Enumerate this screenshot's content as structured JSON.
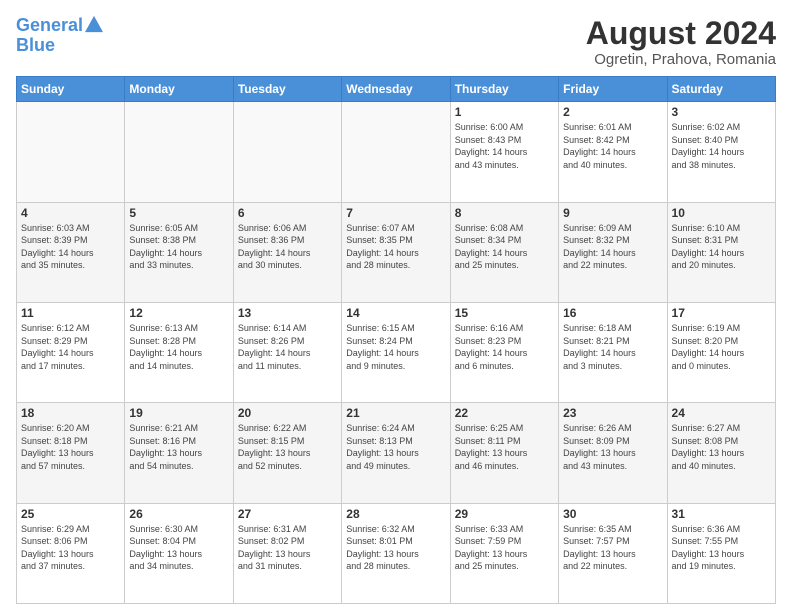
{
  "logo": {
    "line1": "General",
    "line2": "Blue"
  },
  "title": "August 2024",
  "subtitle": "Ogretin, Prahova, Romania",
  "days_header": [
    "Sunday",
    "Monday",
    "Tuesday",
    "Wednesday",
    "Thursday",
    "Friday",
    "Saturday"
  ],
  "weeks": [
    [
      {
        "day": "",
        "info": ""
      },
      {
        "day": "",
        "info": ""
      },
      {
        "day": "",
        "info": ""
      },
      {
        "day": "",
        "info": ""
      },
      {
        "day": "1",
        "info": "Sunrise: 6:00 AM\nSunset: 8:43 PM\nDaylight: 14 hours\nand 43 minutes."
      },
      {
        "day": "2",
        "info": "Sunrise: 6:01 AM\nSunset: 8:42 PM\nDaylight: 14 hours\nand 40 minutes."
      },
      {
        "day": "3",
        "info": "Sunrise: 6:02 AM\nSunset: 8:40 PM\nDaylight: 14 hours\nand 38 minutes."
      }
    ],
    [
      {
        "day": "4",
        "info": "Sunrise: 6:03 AM\nSunset: 8:39 PM\nDaylight: 14 hours\nand 35 minutes."
      },
      {
        "day": "5",
        "info": "Sunrise: 6:05 AM\nSunset: 8:38 PM\nDaylight: 14 hours\nand 33 minutes."
      },
      {
        "day": "6",
        "info": "Sunrise: 6:06 AM\nSunset: 8:36 PM\nDaylight: 14 hours\nand 30 minutes."
      },
      {
        "day": "7",
        "info": "Sunrise: 6:07 AM\nSunset: 8:35 PM\nDaylight: 14 hours\nand 28 minutes."
      },
      {
        "day": "8",
        "info": "Sunrise: 6:08 AM\nSunset: 8:34 PM\nDaylight: 14 hours\nand 25 minutes."
      },
      {
        "day": "9",
        "info": "Sunrise: 6:09 AM\nSunset: 8:32 PM\nDaylight: 14 hours\nand 22 minutes."
      },
      {
        "day": "10",
        "info": "Sunrise: 6:10 AM\nSunset: 8:31 PM\nDaylight: 14 hours\nand 20 minutes."
      }
    ],
    [
      {
        "day": "11",
        "info": "Sunrise: 6:12 AM\nSunset: 8:29 PM\nDaylight: 14 hours\nand 17 minutes."
      },
      {
        "day": "12",
        "info": "Sunrise: 6:13 AM\nSunset: 8:28 PM\nDaylight: 14 hours\nand 14 minutes."
      },
      {
        "day": "13",
        "info": "Sunrise: 6:14 AM\nSunset: 8:26 PM\nDaylight: 14 hours\nand 11 minutes."
      },
      {
        "day": "14",
        "info": "Sunrise: 6:15 AM\nSunset: 8:24 PM\nDaylight: 14 hours\nand 9 minutes."
      },
      {
        "day": "15",
        "info": "Sunrise: 6:16 AM\nSunset: 8:23 PM\nDaylight: 14 hours\nand 6 minutes."
      },
      {
        "day": "16",
        "info": "Sunrise: 6:18 AM\nSunset: 8:21 PM\nDaylight: 14 hours\nand 3 minutes."
      },
      {
        "day": "17",
        "info": "Sunrise: 6:19 AM\nSunset: 8:20 PM\nDaylight: 14 hours\nand 0 minutes."
      }
    ],
    [
      {
        "day": "18",
        "info": "Sunrise: 6:20 AM\nSunset: 8:18 PM\nDaylight: 13 hours\nand 57 minutes."
      },
      {
        "day": "19",
        "info": "Sunrise: 6:21 AM\nSunset: 8:16 PM\nDaylight: 13 hours\nand 54 minutes."
      },
      {
        "day": "20",
        "info": "Sunrise: 6:22 AM\nSunset: 8:15 PM\nDaylight: 13 hours\nand 52 minutes."
      },
      {
        "day": "21",
        "info": "Sunrise: 6:24 AM\nSunset: 8:13 PM\nDaylight: 13 hours\nand 49 minutes."
      },
      {
        "day": "22",
        "info": "Sunrise: 6:25 AM\nSunset: 8:11 PM\nDaylight: 13 hours\nand 46 minutes."
      },
      {
        "day": "23",
        "info": "Sunrise: 6:26 AM\nSunset: 8:09 PM\nDaylight: 13 hours\nand 43 minutes."
      },
      {
        "day": "24",
        "info": "Sunrise: 6:27 AM\nSunset: 8:08 PM\nDaylight: 13 hours\nand 40 minutes."
      }
    ],
    [
      {
        "day": "25",
        "info": "Sunrise: 6:29 AM\nSunset: 8:06 PM\nDaylight: 13 hours\nand 37 minutes."
      },
      {
        "day": "26",
        "info": "Sunrise: 6:30 AM\nSunset: 8:04 PM\nDaylight: 13 hours\nand 34 minutes."
      },
      {
        "day": "27",
        "info": "Sunrise: 6:31 AM\nSunset: 8:02 PM\nDaylight: 13 hours\nand 31 minutes."
      },
      {
        "day": "28",
        "info": "Sunrise: 6:32 AM\nSunset: 8:01 PM\nDaylight: 13 hours\nand 28 minutes."
      },
      {
        "day": "29",
        "info": "Sunrise: 6:33 AM\nSunset: 7:59 PM\nDaylight: 13 hours\nand 25 minutes."
      },
      {
        "day": "30",
        "info": "Sunrise: 6:35 AM\nSunset: 7:57 PM\nDaylight: 13 hours\nand 22 minutes."
      },
      {
        "day": "31",
        "info": "Sunrise: 6:36 AM\nSunset: 7:55 PM\nDaylight: 13 hours\nand 19 minutes."
      }
    ]
  ]
}
